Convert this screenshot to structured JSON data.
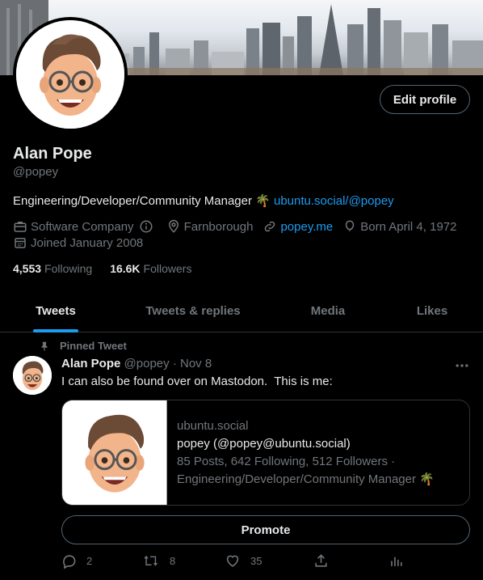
{
  "profile": {
    "name": "Alan Pope",
    "handle": "@popey",
    "edit_label": "Edit profile",
    "bio_text": "Engineering/Developer/Community Manager 🌴 ",
    "bio_link": "ubuntu.social/@popey",
    "meta": {
      "category": "Software Company",
      "location": "Farnborough",
      "website": "popey.me",
      "birthday": "Born April 4, 1972",
      "joined": "Joined January 2008"
    },
    "following_count": "4,553",
    "following_label": "Following",
    "followers_count": "16.6K",
    "followers_label": "Followers"
  },
  "tabs": [
    {
      "label": "Tweets",
      "active": true
    },
    {
      "label": "Tweets & replies",
      "active": false
    },
    {
      "label": "Media",
      "active": false
    },
    {
      "label": "Likes",
      "active": false
    }
  ],
  "tweet": {
    "pinned_label": "Pinned Tweet",
    "author_name": "Alan Pope",
    "author_handle": "@popey",
    "separator": "·",
    "date": "Nov 8",
    "text": "I can also be found over on Mastodon.  This is me:",
    "card": {
      "domain": "ubuntu.social",
      "title": "popey (@popey@ubuntu.social)",
      "description": "85 Posts, 642 Following, 512 Followers · Engineering/Developer/Community Manager 🌴"
    },
    "promote_label": "Promote",
    "replies": "2",
    "retweets": "8",
    "likes": "35"
  },
  "colors": {
    "background": "#000000",
    "accent": "#1d9bf0",
    "text_primary": "#e7e9ea",
    "text_secondary": "#71767b",
    "border": "#2f3336"
  },
  "icons": [
    "briefcase-icon",
    "info-icon",
    "location-pin-icon",
    "link-icon",
    "balloon-icon",
    "calendar-icon",
    "pin-icon",
    "more-icon",
    "reply-icon",
    "retweet-icon",
    "like-icon",
    "share-icon",
    "analytics-icon"
  ]
}
